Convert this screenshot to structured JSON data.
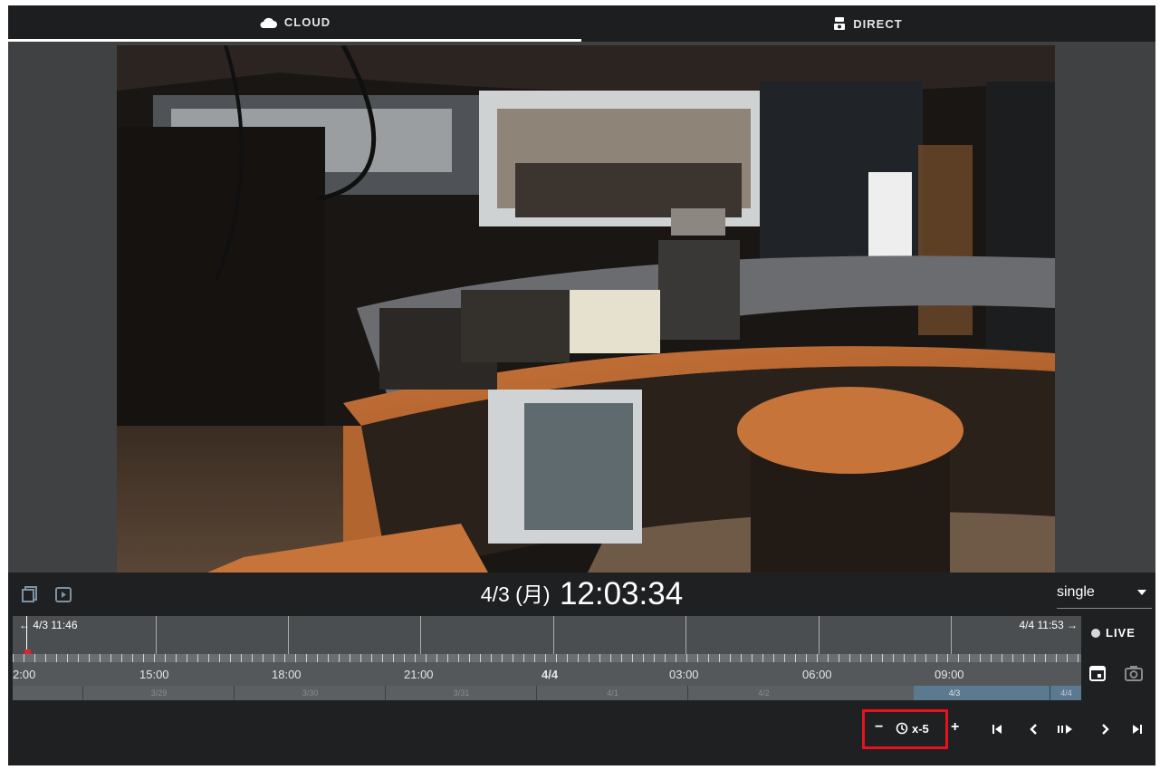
{
  "tabs": [
    {
      "label": "CLOUD",
      "icon": "cloud-icon",
      "active": true
    },
    {
      "label": "DIRECT",
      "icon": "camera-icon",
      "active": false
    }
  ],
  "player": {
    "date": "4/3 (月)",
    "time": "12:03:34",
    "view_mode": "single",
    "live_label": "LIVE"
  },
  "timeline": {
    "start_label": "4/3 11:46",
    "end_label": "4/4 11:53",
    "hour_labels": [
      "2:00",
      "15:00",
      "18:00",
      "21:00",
      "4/4",
      "03:00",
      "06:00",
      "09:00"
    ],
    "day_labels": [
      "3/29",
      "3/30",
      "3/31",
      "4/1",
      "4/2",
      "4/3",
      "4/4"
    ]
  },
  "controls": {
    "speed": "x-5",
    "speed_minus": "−",
    "speed_plus": "+"
  },
  "colors": {
    "highlight": "#e8111e",
    "playhead": "#e0242b",
    "panel": "#1f2022",
    "selected_range": "#5b7a8f"
  }
}
